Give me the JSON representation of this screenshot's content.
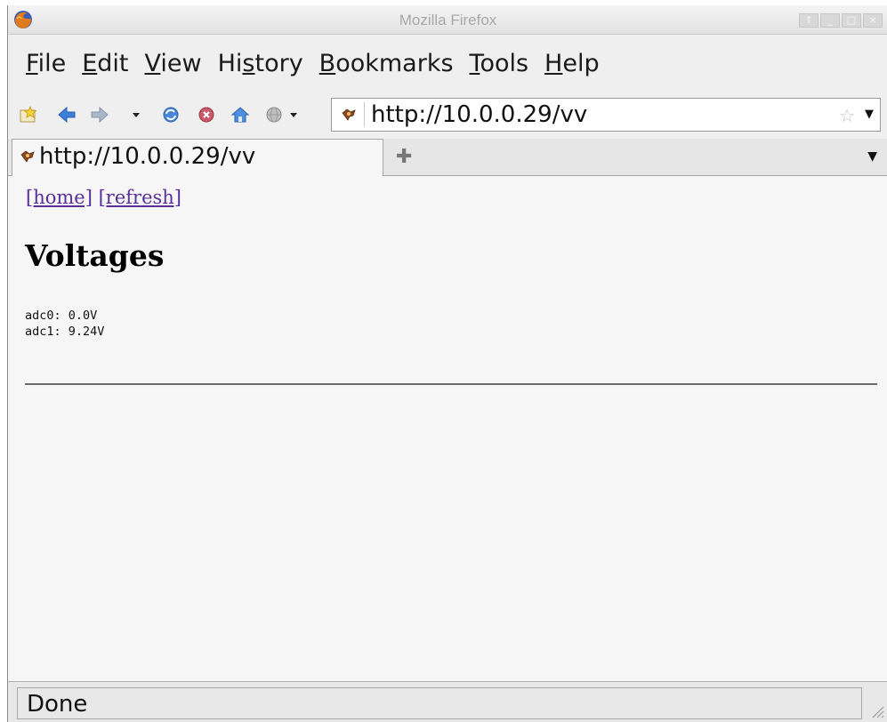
{
  "window": {
    "title": "Mozilla Firefox",
    "controls": [
      "↑",
      "_",
      "□",
      "×"
    ]
  },
  "menubar": {
    "items": [
      {
        "accel": "F",
        "rest": "ile"
      },
      {
        "accel": "E",
        "rest": "dit"
      },
      {
        "accel": "V",
        "rest": "iew"
      },
      {
        "pre": "Hi",
        "accel": "s",
        "rest": "tory"
      },
      {
        "accel": "B",
        "rest": "ookmarks"
      },
      {
        "accel": "T",
        "rest": "ools"
      },
      {
        "accel": "H",
        "rest": "elp"
      }
    ]
  },
  "toolbar": {
    "icons": [
      "bookmark-star-icon",
      "back-arrow-icon",
      "forward-arrow-icon",
      "history-dropdown-icon",
      "reload-icon",
      "stop-icon",
      "home-icon",
      "globe-icon"
    ],
    "url": "http://10.0.0.29/vv"
  },
  "tabs": {
    "active_label": "http://10.0.0.29/vv",
    "new_tab_icon": "plus-icon",
    "list_icon": "chevron-down-icon"
  },
  "page": {
    "links": [
      "[home]",
      "[refresh]"
    ],
    "heading": "Voltages",
    "readings": [
      "adc0: 0.0V",
      "adc1: 9.24V"
    ],
    "link_color": "#5b2f9a"
  },
  "statusbar": {
    "text": "Done"
  }
}
